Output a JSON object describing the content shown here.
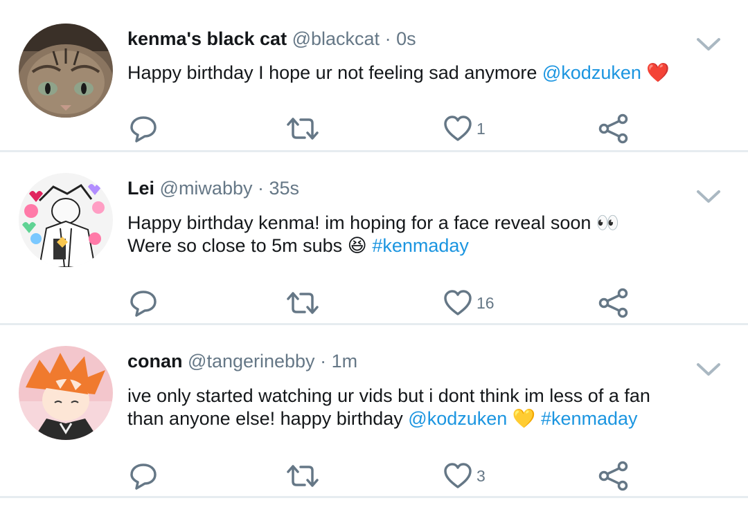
{
  "tweets": [
    {
      "name": "kenma's black cat",
      "handle": "@blackcat",
      "separator": "·",
      "time": "0s",
      "line1_text": "Happy birthday I hope ur not feeling sad anymore ",
      "line1_link": "@kodzuken",
      "line1_emoji": "❤️",
      "like_count": "1",
      "avatar_icon": "cat-photo-avatar"
    },
    {
      "name": "Lei",
      "handle": "@miwabby",
      "separator": "·",
      "time": "35s",
      "line1_text": "Happy birthday kenma! im hoping for a face reveal soon ",
      "line1_emoji": "👀",
      "line2_text": "Were so close to 5m subs ",
      "line2_emoji": "😆",
      "line2_link": "#kenmaday",
      "like_count": "16",
      "avatar_icon": "anime-sketch-avatar"
    },
    {
      "name": "conan",
      "handle": "@tangerinebby",
      "separator": "·",
      "time": "1m",
      "line1_text": "ive only started watching ur vids but i dont think im less of a fan",
      "line2_text": "than anyone else! happy birthday ",
      "line2_link": "@kodzuken",
      "line2_emoji": "💛",
      "line2_link2": "#kenmaday",
      "like_count": "3",
      "avatar_icon": "orange-hair-avatar"
    }
  ],
  "colors": {
    "link": "#1b95e0",
    "secondary": "#657786",
    "divider": "#e6ecf0",
    "icon": "#657786"
  },
  "icons": [
    "reply-icon",
    "retweet-icon",
    "like-icon",
    "share-icon",
    "chevron-down-icon"
  ]
}
